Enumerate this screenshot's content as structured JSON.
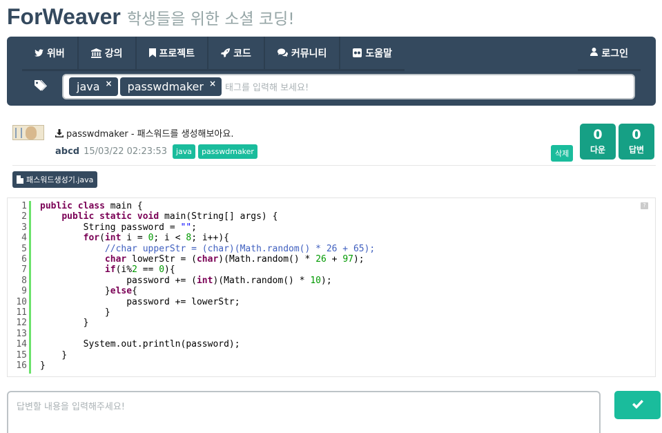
{
  "header": {
    "brand": "ForWeaver",
    "tagline": "학생들을 위한 소셜 코딩!"
  },
  "nav": {
    "items": [
      {
        "label": "위버",
        "icon": "twitter-icon"
      },
      {
        "label": "강의",
        "icon": "bank-icon"
      },
      {
        "label": "프로젝트",
        "icon": "bookmark-icon"
      },
      {
        "label": "코드",
        "icon": "rocket-icon"
      },
      {
        "label": "커뮤니티",
        "icon": "comments-icon"
      },
      {
        "label": "도움말",
        "icon": "flickr-icon"
      }
    ],
    "login": "로그인"
  },
  "tags": {
    "items": [
      "java",
      "passwdmaker"
    ],
    "placeholder": "태그를 입력해 보세요!"
  },
  "post": {
    "title": "passwdmaker - 패스워드를 생성해보아요.",
    "author": "abcd",
    "date": "15/03/22 02:23:53",
    "tags": [
      "java",
      "passwdmaker"
    ],
    "delete_label": "삭제",
    "download_count": "0",
    "download_label": "다운",
    "answer_count": "0",
    "answer_label": "답변"
  },
  "file": {
    "name": "패스워드생성기.java"
  },
  "code": {
    "help": "?",
    "line_numbers": [
      "1",
      "2",
      "3",
      "4",
      "5",
      "6",
      "7",
      "8",
      "9",
      "10",
      "11",
      "12",
      "13",
      "14",
      "15",
      "16"
    ],
    "lines": [
      "public class main {",
      "    public static void main(String[] args) {",
      "        String password = \"\";",
      "        for(int i = 0; i < 8; i++){",
      "            //char upperStr = (char)(Math.random() * 26 + 65);",
      "            char lowerStr = (char)(Math.random() * 26 + 97);",
      "            if(i%2 == 0){",
      "                password += (int)(Math.random() * 10);",
      "            }else{",
      "                password += lowerStr;",
      "            }",
      "        }",
      "",
      "        System.out.println(password);",
      "    }",
      "}"
    ]
  },
  "answer": {
    "placeholder": "답변할 내용을 입력해주세요!"
  },
  "colors": {
    "navbar": "#34495e",
    "accent": "#1abc9c",
    "counter": "#16a085"
  }
}
